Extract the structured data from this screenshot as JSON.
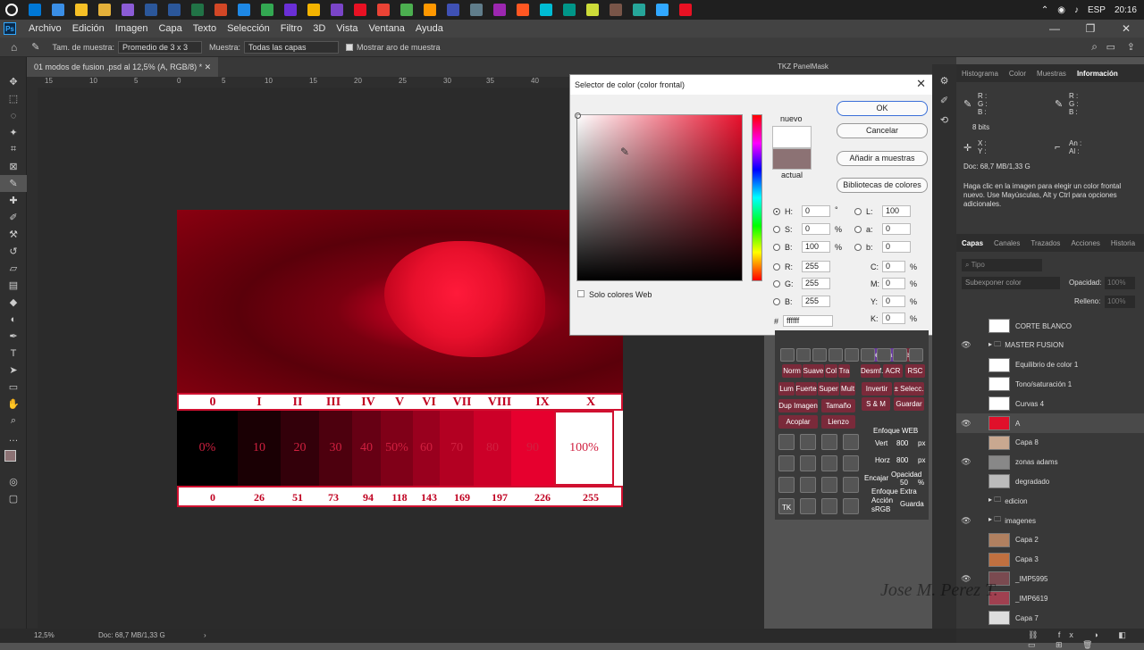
{
  "taskbar": {
    "icons": [
      "#fff",
      "#0078d7",
      "#3a8ee6",
      "#f6c026",
      "#e5b13a",
      "#8b5cd6",
      "#2b579a",
      "#2b579a",
      "#217346",
      "#d24726",
      "#1e88e5",
      "#33a852",
      "#6a2fd6",
      "#f4b400",
      "#7a45c8",
      "#e81123",
      "#ea4335",
      "#4caf50",
      "#ff9800",
      "#3f51b5",
      "#607d8b",
      "#9c27b0",
      "#ff5722",
      "#00bcd4",
      "#009688",
      "#cddc39",
      "#795548",
      "#26a69a",
      "#31a8ff",
      "#e81123"
    ],
    "tray": {
      "lang": "ESP",
      "time": "20:16"
    }
  },
  "menubar": {
    "logo": "Ps",
    "items": [
      "Archivo",
      "Edición",
      "Imagen",
      "Capa",
      "Texto",
      "Selección",
      "Filtro",
      "3D",
      "Vista",
      "Ventana",
      "Ayuda"
    ],
    "window_controls": [
      "—",
      "❐",
      "✕"
    ]
  },
  "options": {
    "sample_size_label": "Tam. de muestra:",
    "sample_size_value": "Promedio de 3 x 3",
    "sample_label": "Muestra:",
    "sample_value": "Todas las capas",
    "ring_label": "Mostrar aro de muestra"
  },
  "document": {
    "tab_title": "01 modos de fusion .psd al 12,5% (A, RGB/8) *",
    "ruler_ticks": [
      "15",
      "10",
      "5",
      "0",
      "5",
      "10",
      "15",
      "20",
      "25",
      "30",
      "35",
      "40"
    ],
    "side_tab": "TKZ PanelMask",
    "roman": [
      "0",
      "I",
      "II",
      "III",
      "IV",
      "V",
      "VI",
      "VII",
      "VIII",
      "IX",
      "X"
    ],
    "percents": [
      "0%",
      "10",
      "20",
      "30",
      "40",
      "50%",
      "60",
      "70",
      "80",
      "90",
      "100%"
    ],
    "values": [
      "0",
      "26",
      "51",
      "73",
      "94",
      "118",
      "143",
      "169",
      "197",
      "226",
      "255"
    ],
    "cell_colors": [
      "#000000",
      "#1a0004",
      "#33000a",
      "#4d000e",
      "#660014",
      "#800018",
      "#99001e",
      "#b30022",
      "#cc0028",
      "#e6002e",
      "#ffffff"
    ]
  },
  "dialog": {
    "title": "Selector de color (color frontal)",
    "new_label": "nuevo",
    "current_label": "actual",
    "new_color": "#ffffff",
    "current_color": "#8c7274",
    "buttons": {
      "ok": "OK",
      "cancel": "Cancelar",
      "add": "Añadir a muestras",
      "libraries": "Bibliotecas de colores"
    },
    "web_only": "Solo colores Web",
    "fields": {
      "H": "0",
      "S": "0",
      "B": "100",
      "R": "255",
      "G": "255",
      "Bv": "255",
      "L": "100",
      "a": "0",
      "b": "0",
      "C": "0",
      "M": "0",
      "Y": "0",
      "K": "0",
      "hex": "ffffff"
    },
    "units": {
      "deg": "°",
      "pct": "%"
    }
  },
  "tk_panel": {
    "buttons": [
      "Contorn.",
      "Relle.",
      "Norm",
      "Suave",
      "Col",
      "Tra",
      "Desmf.",
      "ACR",
      "RSC",
      "Lum",
      "Fuerte",
      "Super",
      "Mult",
      "Invertir",
      "± Selecc.",
      "Dup Imagen",
      "Tamaño",
      "S & M",
      "Guardar",
      "Acoplar",
      "Lienzo"
    ],
    "web_header": "Enfoque WEB",
    "vert": "Vert",
    "vert_val": "800",
    "horz": "Horz",
    "horz_val": "800",
    "px": "px",
    "encajar": "Encajar",
    "opacidad": "Opacidad",
    "opac_val": "50",
    "pct": "%",
    "enfoque_extra": "Enfoque Extra",
    "accion": "Acción",
    "srgb": "sRGB",
    "guarda": "Guarda",
    "tk": "TK"
  },
  "info_panel": {
    "tabs": [
      "Histograma",
      "Color",
      "Muestras",
      "Información"
    ],
    "rgb": [
      "R :",
      "G :",
      "B :"
    ],
    "bits": "8 bits",
    "xy": [
      "X :",
      "Y :"
    ],
    "anal": [
      "An :",
      "Al :"
    ],
    "doc": "Doc: 68,7 MB/1,33 G",
    "hint": "Haga clic en la imagen para elegir un color frontal nuevo. Use Mayúsculas, Alt y Ctrl para opciones adicionales."
  },
  "layers_panel": {
    "tabs": [
      "Capas",
      "Canales",
      "Trazados",
      "Acciones",
      "Historia"
    ],
    "search": "Tipo",
    "blend": "Subexponer color",
    "opacity_label": "Opacidad:",
    "opacity_val": "100%",
    "fill_label": "Relleno:",
    "fill_val": "100%",
    "layers": [
      {
        "name": "CORTE BLANCO",
        "eye": false,
        "thumb": "#ffffff"
      },
      {
        "name": "MASTER FUSION",
        "eye": true,
        "group": true
      },
      {
        "name": "Equilibrio de color 1",
        "eye": false,
        "thumb": "#ffffff"
      },
      {
        "name": "Tono/saturación 1",
        "eye": false,
        "thumb": "#ffffff"
      },
      {
        "name": "Curvas 4",
        "eye": false,
        "thumb": "#ffffff"
      },
      {
        "name": "A",
        "eye": true,
        "thumb": "#e0102a"
      },
      {
        "name": "Capa 8",
        "eye": false,
        "thumb": "#c9a890"
      },
      {
        "name": "zonas adams",
        "eye": true,
        "thumb": "#888888"
      },
      {
        "name": "degradado",
        "eye": false,
        "thumb": "#bbbbbb"
      },
      {
        "name": "edicion",
        "eye": false,
        "group": true
      },
      {
        "name": "imagenes",
        "eye": true,
        "group": true
      },
      {
        "name": "Capa 2",
        "eye": false,
        "thumb": "#b08060"
      },
      {
        "name": "Capa 3",
        "eye": false,
        "thumb": "#c07040"
      },
      {
        "name": "_IMP5995",
        "eye": true,
        "thumb": "#7a4a50"
      },
      {
        "name": "_IMP6619",
        "eye": false,
        "thumb": "#a04050"
      },
      {
        "name": "Capa 7",
        "eye": false,
        "thumb": "#dddddd"
      }
    ]
  },
  "status": {
    "zoom": "12,5%",
    "doc": "Doc: 68,7 MB/1,33 G"
  },
  "watermark": "Jose M. Perez T."
}
